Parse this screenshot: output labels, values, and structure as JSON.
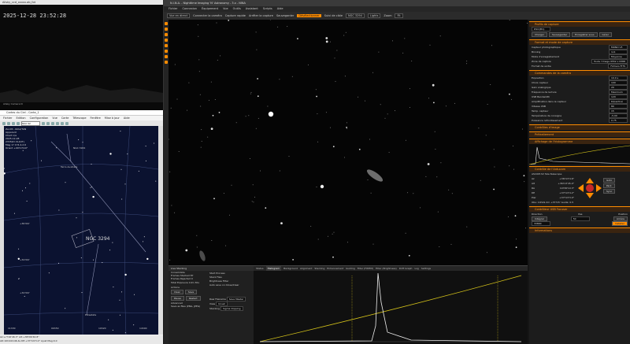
{
  "allsky": {
    "title": "Allsky_ccd_xxxxx.ab_fot",
    "timestamp": "2025-12-28 23:52:28",
    "caption": "Allsky Camera N"
  },
  "cdc": {
    "title": "Cartes du Ciel - Carte_1",
    "menu": [
      "Fichier",
      "Edition",
      "Configuration",
      "Vue",
      "Carte",
      "Télescope",
      "Fenêtre",
      "Mise à jour",
      "Aide"
    ],
    "search_value": "NGC 32",
    "info_lines": "Zenith  AltAz/TAN\nApparent\nChart n/a\n2025-12-28\n23h52m SU(UT)\nMag 1? 174.4,2.6\nOrient +00?17m0\"",
    "labels": {
      "ngc": "NGC 3294",
      "terra": "Terra Australis",
      "ngc_small": "NGC 3184",
      "psc": "Potestate"
    },
    "ra_labels": [
      "11h30",
      "14h00",
      "09h50",
      "10h20"
    ],
    "dec_labels": [
      "+36?00'",
      "+34?00'",
      "+32?00'",
      "+30?00'",
      "+28?00'"
    ],
    "status1": "Az:+??16'46.3\" Alt:+38?06'40.8\"",
    "status2": "AD:10h44m46.4s DE:+37?19'3.0\" Ajust Mag:0.0"
  },
  "nina": {
    "title": "N.I.N.A. - Nighttime Imaging 'N' Astronomy - 3.x - NINA",
    "menu": [
      "Fichier",
      "Connexion",
      "Équipement",
      "Vue",
      "Outils",
      "Assistant",
      "Scripts",
      "Aide"
    ],
    "toolbar": {
      "live_view": "Vue en direct",
      "connect_cam": "Connecter la caméra",
      "capture": "Capture rapide",
      "stop": "Arrêter la capture",
      "save": "Sauvegarder",
      "deselect": "Désélectionner",
      "framing": "Suivi de cible",
      "target": "NGC 3294",
      "filter": "Lights",
      "zoom_label": "Zoom",
      "zoom_value": "Fit"
    },
    "right": {
      "profile_header": "Profils de capture",
      "profile_value": "DSO(M1)",
      "profile_buttons": [
        "Charger",
        "Sauvegarder",
        "Enregistrer sous",
        "Gérer"
      ],
      "format_header": "Format et mode de capture",
      "type_label": "Capteur photographique",
      "type_value": "MONO V3",
      "binning_label": "Binning",
      "binning_value": "1x1",
      "mode_label": "Mode d'enregistrement",
      "mode_value": "Moyenne",
      "area_label": "Zone de capture",
      "area_value": "Toute l'image 9552 x 6388",
      "file_label": "Format de sortie",
      "file_value": "Fichiers FITS",
      "cmd_header": "Commandes de la caméra",
      "exposure_label": "Exposition",
      "exposure_value": "10.0 s",
      "gain_label": "Choix capteur",
      "gain_value": "100",
      "offset_label": "Gain analogique",
      "offset_value": "20",
      "bias_label": "Fréquence de lecture",
      "bias_value": "Maximum",
      "usb_label": "USB Bandwidth",
      "usb_value": "120",
      "amp_label": "Amplification dans le capteur",
      "amp_value": "Désactivé",
      "speed_label": "Vitesse USB",
      "speed_value": "80",
      "temp_label": "Temp. capteur",
      "temp_value": "15",
      "setpoint_label": "Température de consigne",
      "setpoint_value": "-5.00",
      "cooler_label": "Puissance refroidissement",
      "cooler_value": "0.75",
      "image_ctrl": "Contrôles d'image",
      "pretreat": "Prétraitement",
      "histo_header": "Affichage de l'histogramme",
      "scope_header": "Contrôle de l'Arducam",
      "scope_name": "ASCOM.SV Tele.Telescope",
      "coords": [
        {
          "k": "Az",
          "v": "+36?13'4.6\""
        },
        {
          "k": "Alt",
          "v": "+36?13'45.0\""
        },
        {
          "k": "RA",
          "v": "10?36'10.3\""
        },
        {
          "k": "DE",
          "v": "+37?13'4.2\""
        },
        {
          "k": "Pier",
          "v": "+37?13'3.0\""
        }
      ],
      "slew_buttons": [
        "Goto",
        "Park",
        "Sync"
      ],
      "status_line": "Obs: 10h19.2m +37?15' Guide: 0.5",
      "focuser_header": "Contrôleur USB Focuser",
      "focuser_cols": [
        "Direction",
        "Pas",
        "Position"
      ],
      "focuser_in": "Intégral",
      "focuser_step": "50",
      "focuser_out": "Arrière",
      "focuser_pos": "33800",
      "focuser_btn": "Installer",
      "notes_header": "Informations"
    },
    "live": {
      "header": "Live Stacking",
      "rows": [
        "Consolidate",
        "Frames Stacked  87",
        "Frames Rejected  0",
        "Total Exposure  14m 30s",
        "",
        "Actions",
        "",
        "",
        "",
        "Advanced"
      ],
      "checks": [
        "Start Process",
        "Stack Files",
        "Brightness Filter",
        "Auto save on Close/Clear"
      ],
      "buttons": [
        "Clear",
        "Save",
        "Pause",
        "Restart"
      ],
      "fields": [
        {
          "k": "Raw Filename",
          "v": "Save Master"
        },
        {
          "k": "View",
          "v": "Unset"
        },
        {
          "k": "Stacking",
          "v": "Sigma Clipping"
        }
      ],
      "save_option": "Save as files (PNG, JPEG)"
    },
    "histo_tabs": [
      "Status",
      "Histogram",
      "Background",
      "Alignment",
      "Stacking",
      "Enhancement",
      "Guiding",
      "Filter (FWHM)",
      "Filter (Brightness)",
      "Drift Graph",
      "Log",
      "Settings"
    ],
    "histo_active": 1
  }
}
